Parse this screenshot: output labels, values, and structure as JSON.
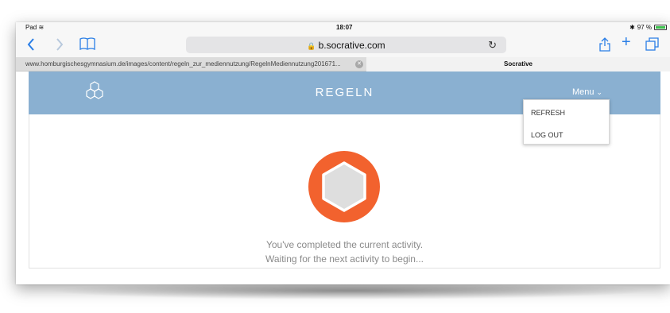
{
  "status_bar": {
    "device": "Pad",
    "time": "18:07",
    "battery": "97 %"
  },
  "browser": {
    "url": "b.socrative.com",
    "tabs": [
      {
        "title": "www.homburgischesgymnasium.de/images/content/regeln_zur_mediennutzung/RegelnMediennutzung201671..."
      },
      {
        "title": "Socrative"
      }
    ],
    "icons": [
      "back-icon",
      "forward-icon",
      "bookmarks-icon",
      "lock-icon",
      "reload-icon",
      "share-icon",
      "new-tab-icon",
      "tabs-icon"
    ]
  },
  "app": {
    "title": "REGELN",
    "menu_label": "Menu",
    "menu_items": [
      {
        "label": "REFRESH"
      },
      {
        "label": "LOG OUT"
      }
    ],
    "message_line1": "You've completed the current activity.",
    "message_line2": "Waiting for the next activity to begin...",
    "colors": {
      "header": "#8ab0d1",
      "badge_outer": "#f2622e",
      "badge_inner": "#dedede",
      "ios_blue": "#2a7ee6"
    }
  }
}
